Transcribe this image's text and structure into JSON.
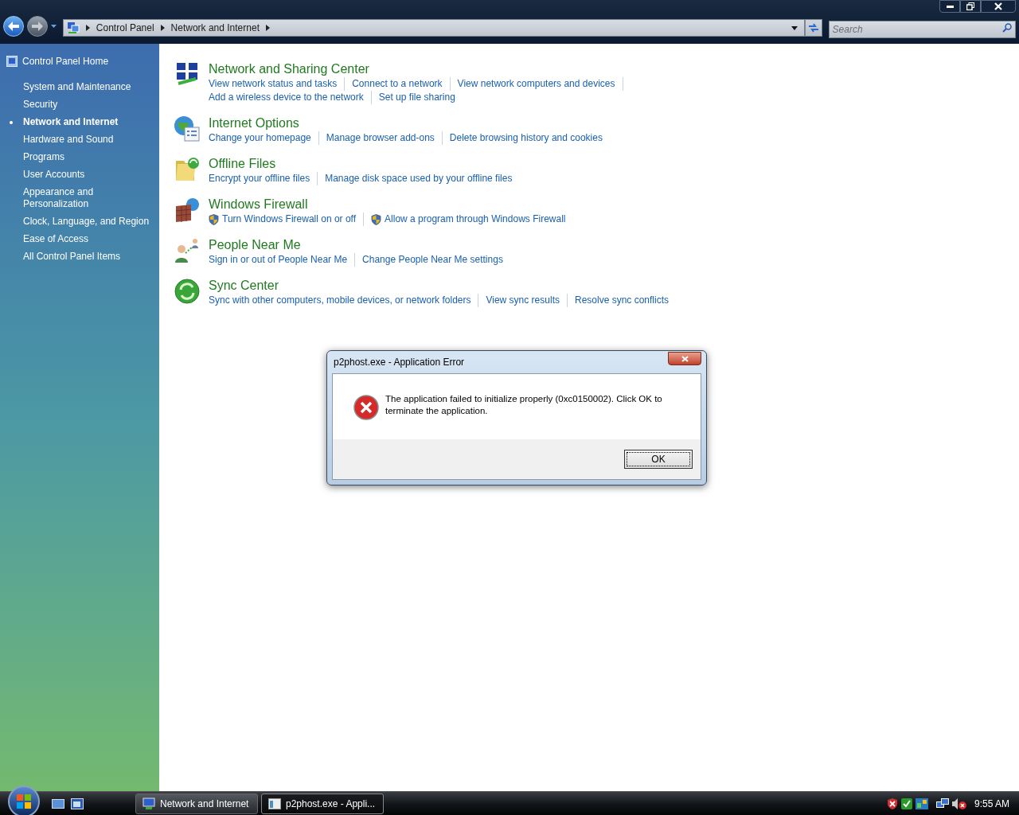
{
  "address_bar": {
    "breadcrumbs": [
      "Control Panel",
      "Network and Internet"
    ]
  },
  "search": {
    "placeholder": "Search"
  },
  "sidebar": {
    "home": "Control Panel Home",
    "items": [
      {
        "label": "System and Maintenance",
        "selected": false
      },
      {
        "label": "Security",
        "selected": false
      },
      {
        "label": "Network and Internet",
        "selected": true
      },
      {
        "label": "Hardware and Sound",
        "selected": false
      },
      {
        "label": "Programs",
        "selected": false
      },
      {
        "label": "User Accounts",
        "selected": false
      },
      {
        "label": "Appearance and Personalization",
        "selected": false
      },
      {
        "label": "Clock, Language, and Region",
        "selected": false
      },
      {
        "label": "Ease of Access",
        "selected": false
      },
      {
        "label": "All Control Panel Items",
        "selected": false
      }
    ]
  },
  "categories": [
    {
      "title": "Network and Sharing Center",
      "rows": [
        [
          {
            "label": "View network status and tasks",
            "shield": false
          },
          {
            "label": "Connect to a network",
            "shield": false
          },
          {
            "label": "View network computers and devices",
            "shield": false
          }
        ],
        [
          {
            "label": "Add a wireless device to the network",
            "shield": false
          },
          {
            "label": "Set up file sharing",
            "shield": false
          }
        ]
      ]
    },
    {
      "title": "Internet Options",
      "rows": [
        [
          {
            "label": "Change your homepage",
            "shield": false
          },
          {
            "label": "Manage browser add-ons",
            "shield": false
          },
          {
            "label": "Delete browsing history and cookies",
            "shield": false
          }
        ]
      ]
    },
    {
      "title": "Offline Files",
      "rows": [
        [
          {
            "label": "Encrypt your offline files",
            "shield": false
          },
          {
            "label": "Manage disk space used by your offline files",
            "shield": false
          }
        ]
      ]
    },
    {
      "title": "Windows Firewall",
      "rows": [
        [
          {
            "label": "Turn Windows Firewall on or off",
            "shield": true
          },
          {
            "label": "Allow a program through Windows Firewall",
            "shield": true
          }
        ]
      ]
    },
    {
      "title": "People Near Me",
      "rows": [
        [
          {
            "label": "Sign in or out of People Near Me",
            "shield": false
          },
          {
            "label": "Change People Near Me settings",
            "shield": false
          }
        ]
      ]
    },
    {
      "title": "Sync Center",
      "rows": [
        [
          {
            "label": "Sync with other computers, mobile devices, or network folders",
            "shield": false
          },
          {
            "label": "View sync results",
            "shield": false
          },
          {
            "label": "Resolve sync conflicts",
            "shield": false
          }
        ]
      ]
    }
  ],
  "dialog": {
    "title": "p2phost.exe - Application Error",
    "message": "The application failed to initialize properly (0xc0150002). Click OK to terminate the application.",
    "button": "OK"
  },
  "taskbar": {
    "buttons": [
      {
        "label": "Network and Internet",
        "selected": false
      },
      {
        "label": "p2phost.exe - Appli...",
        "selected": true
      }
    ],
    "clock": "9:55 AM"
  }
}
